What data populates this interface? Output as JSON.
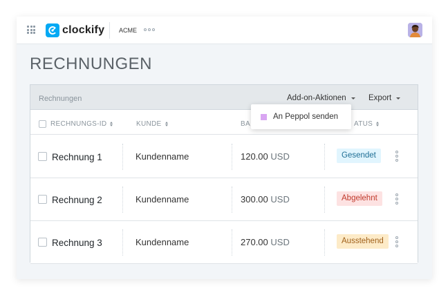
{
  "app": {
    "logo_text": "clockify",
    "workspace": "ACME"
  },
  "page": {
    "title": "RECHNUNGEN"
  },
  "card": {
    "title": "Rechnungen",
    "addon_actions_label": "Add-on-Aktionen",
    "export_label": "Export"
  },
  "dropdown": {
    "item_label": "An Peppol senden",
    "item_color": "#d9a6f2"
  },
  "columns": {
    "id": "RECHNUNGS-ID",
    "client": "KUNDE",
    "amount": "BA",
    "status": "ATUS"
  },
  "rows": [
    {
      "name": "Rechnung 1",
      "client": "Kundenname",
      "amount": "120.00",
      "currency": "USD",
      "status": "Gesendet"
    },
    {
      "name": "Rechnung 2",
      "client": "Kundenname",
      "amount": "300.00",
      "currency": "USD",
      "status": "Abgelehnt"
    },
    {
      "name": "Rechnung 3",
      "client": "Kundenname",
      "amount": "270.00",
      "currency": "USD",
      "status": "Ausstehend"
    }
  ],
  "colors": {
    "brand": "#03a9f4",
    "sent": "#e1f5fe",
    "rejected": "#fde2e2",
    "pending": "#fdebc8"
  }
}
